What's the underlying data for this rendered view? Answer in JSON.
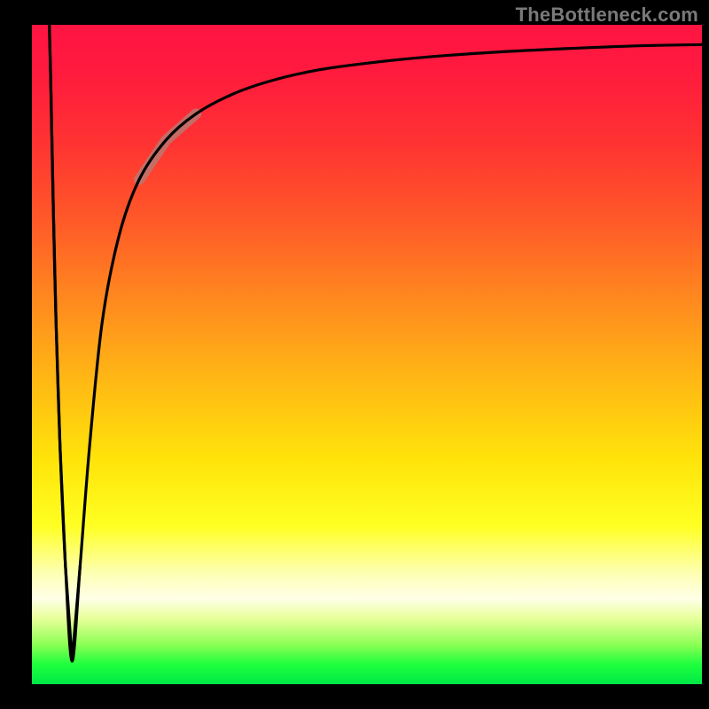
{
  "watermark": "TheBottleneck.com",
  "chart_data": {
    "type": "line",
    "title": "",
    "xlabel": "",
    "ylabel": "",
    "xlim": [
      0,
      100
    ],
    "ylim": [
      0,
      100
    ],
    "grid": false,
    "legend": false,
    "background": "rainbow-gradient red→yellow→green (top→bottom)",
    "series": [
      {
        "name": "main-curve",
        "x": [
          2.6,
          2.8,
          3.2,
          3.6,
          4.2,
          5.0,
          6.0,
          7.2,
          8.6,
          10.5,
          13.0,
          16.0,
          20.0,
          24.5,
          30.0,
          36.0,
          43.0,
          51.0,
          60.0,
          70.0,
          80.0,
          90.0,
          100.0
        ],
        "y": [
          100.0,
          92.0,
          72.0,
          55.0,
          36.0,
          18.0,
          3.5,
          18.0,
          36.0,
          55.0,
          68.0,
          76.5,
          82.5,
          86.5,
          89.5,
          91.6,
          93.2,
          94.3,
          95.2,
          95.9,
          96.4,
          96.8,
          97.0
        ]
      }
    ],
    "highlight": {
      "note": "muted pink segment overlay on rising branch",
      "x_range": [
        16.0,
        24.5
      ],
      "y_range": [
        76.5,
        86.5
      ]
    },
    "spike_note": "curve starts at top-left, plunges to near-zero at x≈6, then asymptotically rises toward y≈97"
  }
}
